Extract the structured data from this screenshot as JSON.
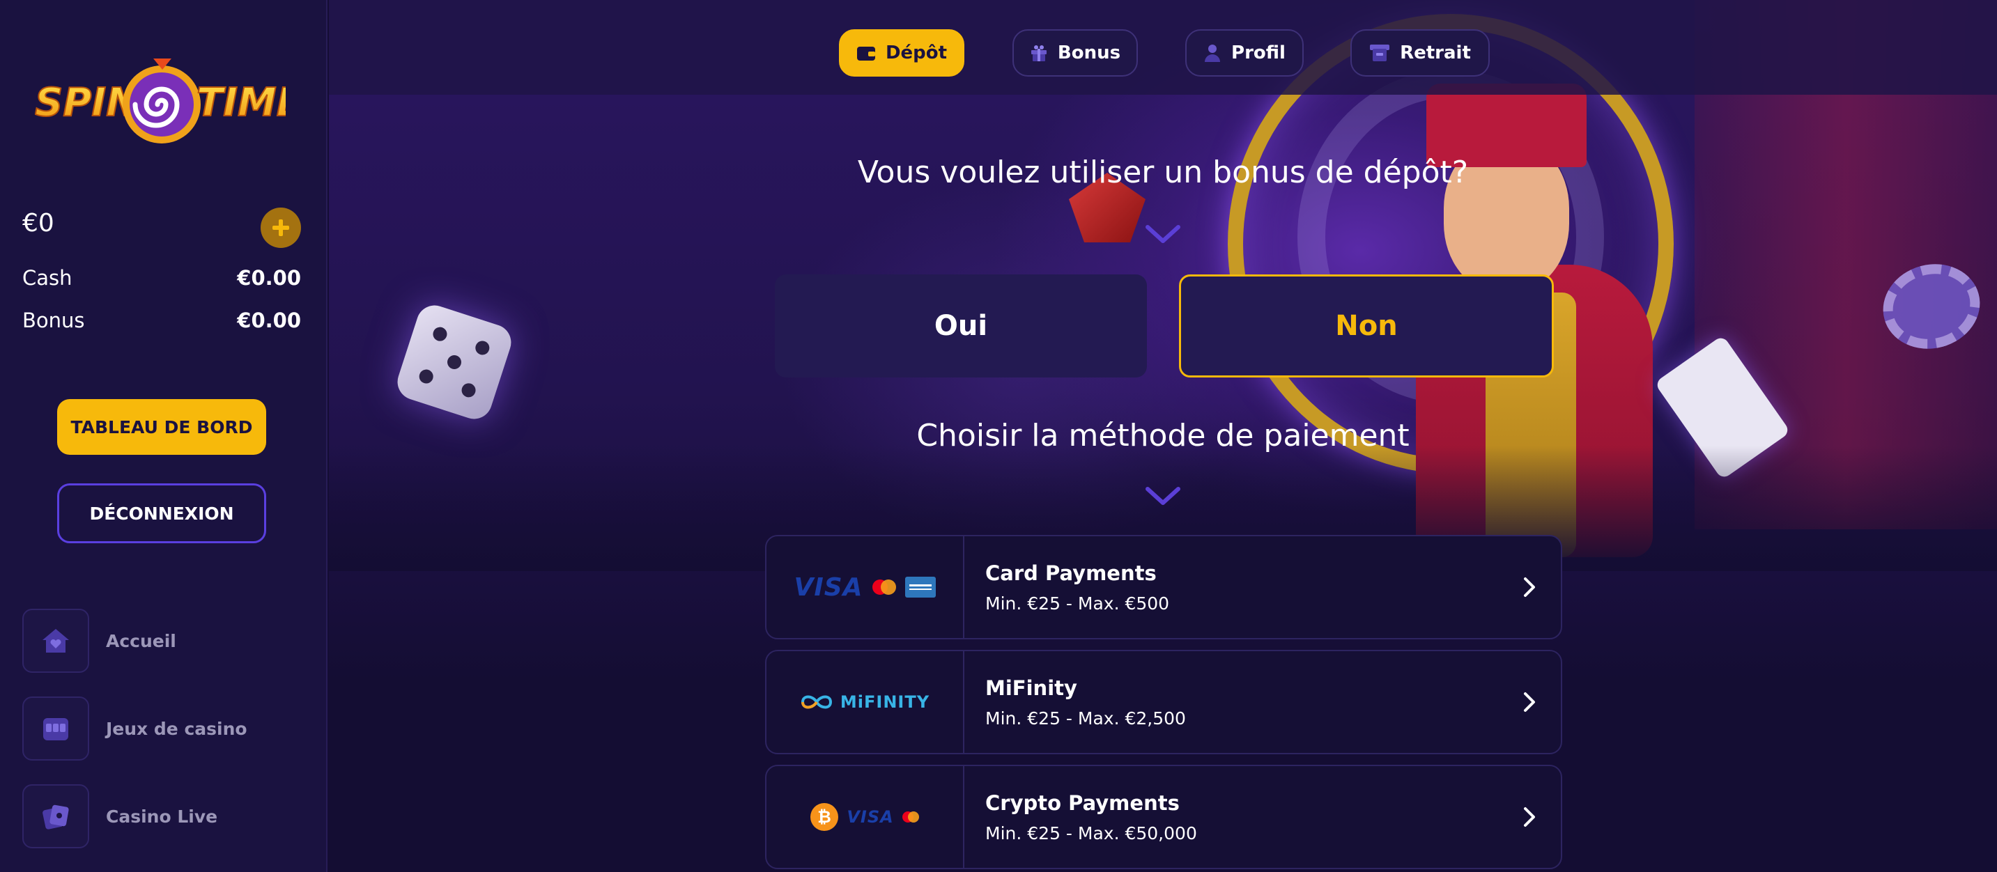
{
  "brand": {
    "logo_text_left": "SPIN",
    "logo_text_right": "TIME",
    "primary_color": "#f7b90b",
    "accent_color": "#5a3fe0"
  },
  "sidebar": {
    "balance_total": "€0",
    "add_funds_icon": "plus-icon",
    "cash_label": "Cash",
    "cash_value": "€0.00",
    "bonus_label": "Bonus",
    "bonus_value": "€0.00",
    "dashboard_button": "TABLEAU DE BORD",
    "logout_button": "DÉCONNEXION",
    "nav": [
      {
        "label": "Accueil",
        "icon": "home-icon"
      },
      {
        "label": "Jeux de casino",
        "icon": "slot-machine-icon"
      },
      {
        "label": "Casino Live",
        "icon": "live-cards-icon"
      }
    ]
  },
  "tabs": [
    {
      "label": "Dépôt",
      "icon": "wallet-icon",
      "active": true
    },
    {
      "label": "Bonus",
      "icon": "gift-icon",
      "active": false
    },
    {
      "label": "Profil",
      "icon": "user-icon",
      "active": false
    },
    {
      "label": "Retrait",
      "icon": "withdraw-icon",
      "active": false
    }
  ],
  "deposit": {
    "bonus_question": "Vous voulez utiliser un bonus de dépôt?",
    "yes_label": "Oui",
    "no_label": "Non",
    "selected": "Non",
    "method_title": "Choisir la méthode de paiement",
    "methods": [
      {
        "name": "Card Payments",
        "limits": "Min. €25 - Max. €500",
        "logos": [
          "VISA",
          "mastercard",
          "amex"
        ]
      },
      {
        "name": "MiFinity",
        "limits": "Min. €25 - Max. €2,500",
        "logos": [
          "MiFINITY"
        ]
      },
      {
        "name": "Crypto Payments",
        "limits": "Min. €25 - Max. €50,000",
        "logos": [
          "bitcoin",
          "VISA",
          "mastercard"
        ]
      }
    ]
  }
}
